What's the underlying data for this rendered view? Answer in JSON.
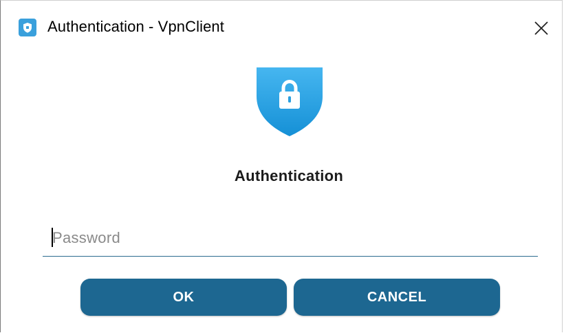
{
  "window": {
    "title": "Authentication - VpnClient",
    "app_icon": "shield-icon",
    "close_icon": "close-icon"
  },
  "main": {
    "logo_icon": "shield-lock-icon",
    "heading": "Authentication",
    "password": {
      "value": "",
      "placeholder": "Password"
    }
  },
  "buttons": {
    "ok_label": "OK",
    "cancel_label": "CANCEL"
  },
  "colors": {
    "accent": "#1d6791",
    "shield_light": "#43b3ee",
    "shield_dark": "#1791d6",
    "underline": "#2a6b8f"
  }
}
